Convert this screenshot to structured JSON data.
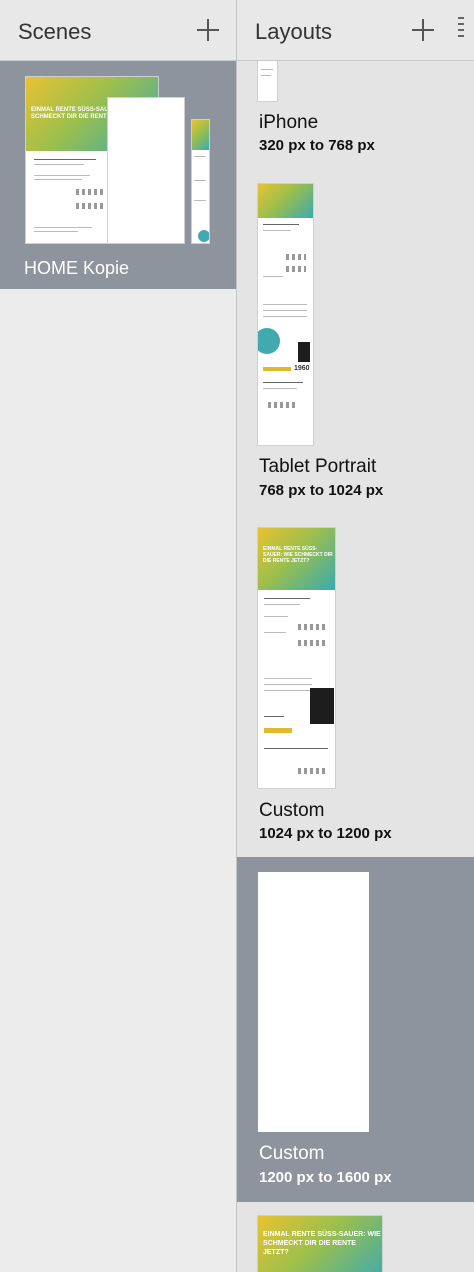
{
  "scenes": {
    "title": "Scenes",
    "items": [
      {
        "label": "HOME Kopie",
        "selected": true
      }
    ]
  },
  "layouts": {
    "title": "Layouts",
    "items": [
      {
        "name": "iPhone",
        "range": "320 px to 768 px",
        "selected": false
      },
      {
        "name": "Tablet Portrait",
        "range": "768 px to 1024 px",
        "selected": false
      },
      {
        "name": "Custom",
        "range": "1024 px to 1200 px",
        "selected": false
      },
      {
        "name": "Custom",
        "range": "1200 px to 1600 px",
        "selected": true
      }
    ]
  },
  "thumbnail_text": {
    "headline": "EINMAL RENTE SÜSS-SAUER: WIE SCHMECKT DIR DIE RENTE JETZT?",
    "year": "1960"
  },
  "colors": {
    "selection": "#8e949e",
    "accent_teal": "#41aab0",
    "accent_yellow": "#e9c232"
  },
  "icons": {
    "add_scene": "plus-icon",
    "add_layout": "plus-icon",
    "panel_menu": "vertical-grip-icon"
  }
}
